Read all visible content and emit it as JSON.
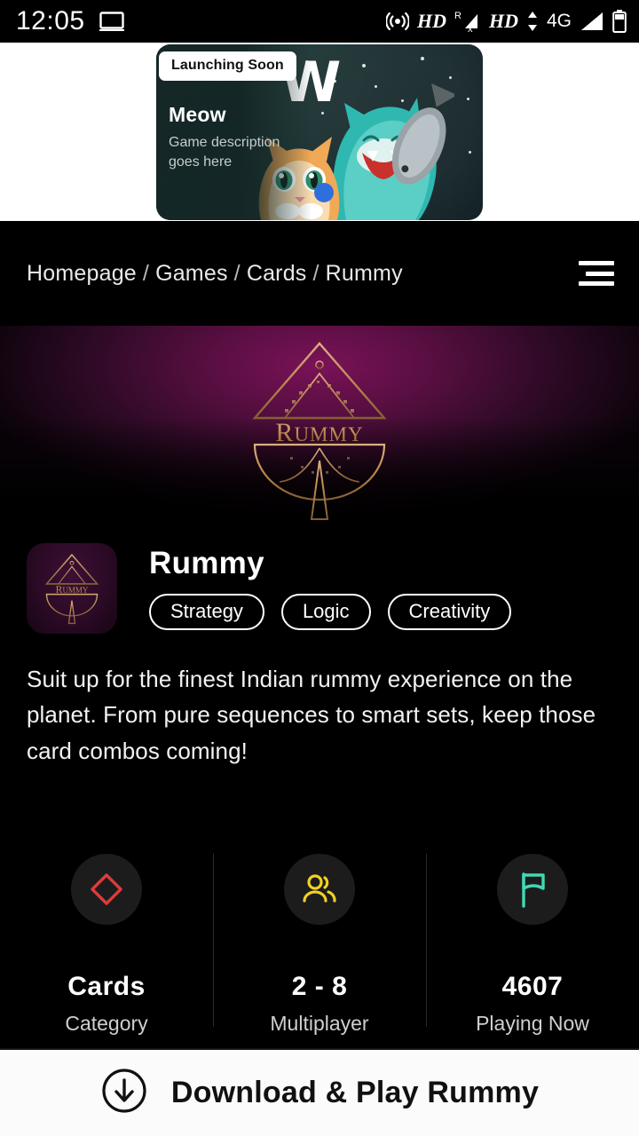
{
  "status_bar": {
    "time": "12:05",
    "left_icons": [
      "screencast-icon"
    ],
    "right_icons": [
      "hotspot-icon",
      "hd-voice-icon",
      "roaming-no-signal-icon",
      "hd-voice-icon",
      "data-transfer-icon",
      "signal-icon",
      "battery-icon"
    ],
    "hd_label": "HD",
    "hd_label_2": "HD",
    "roaming_label": "R",
    "network_label": "4G"
  },
  "promo": {
    "badge": "Launching Soon",
    "title": "Meow",
    "description": "Game description goes here",
    "watermark": "W"
  },
  "breadcrumb": {
    "items": [
      "Homepage",
      "Games",
      "Cards",
      "Rummy"
    ],
    "separator": "/",
    "menu_icon": "hamburger-icon"
  },
  "hero": {
    "logo_text": "Rummy",
    "accent_gold": "#c98f4e",
    "bg_magenta": "#7a1258"
  },
  "app": {
    "name": "Rummy",
    "icon_text": "Rummy",
    "tags": [
      "Strategy",
      "Logic",
      "Creativity"
    ],
    "description": "Suit up for the finest Indian rummy experience on the planet. From pure sequences to smart sets, keep those card combos coming!"
  },
  "stats": [
    {
      "icon": "diamond-icon",
      "icon_color": "#e03a3a",
      "value": "Cards",
      "label": "Category"
    },
    {
      "icon": "people-icon",
      "icon_color": "#f2d024",
      "value": "2 - 8",
      "label": "Multiplayer"
    },
    {
      "icon": "flag-icon",
      "icon_color": "#3fd9b4",
      "value": "4607",
      "label": "Playing Now"
    }
  ],
  "cta": {
    "icon": "download-circle-icon",
    "label": "Download & Play Rummy"
  }
}
